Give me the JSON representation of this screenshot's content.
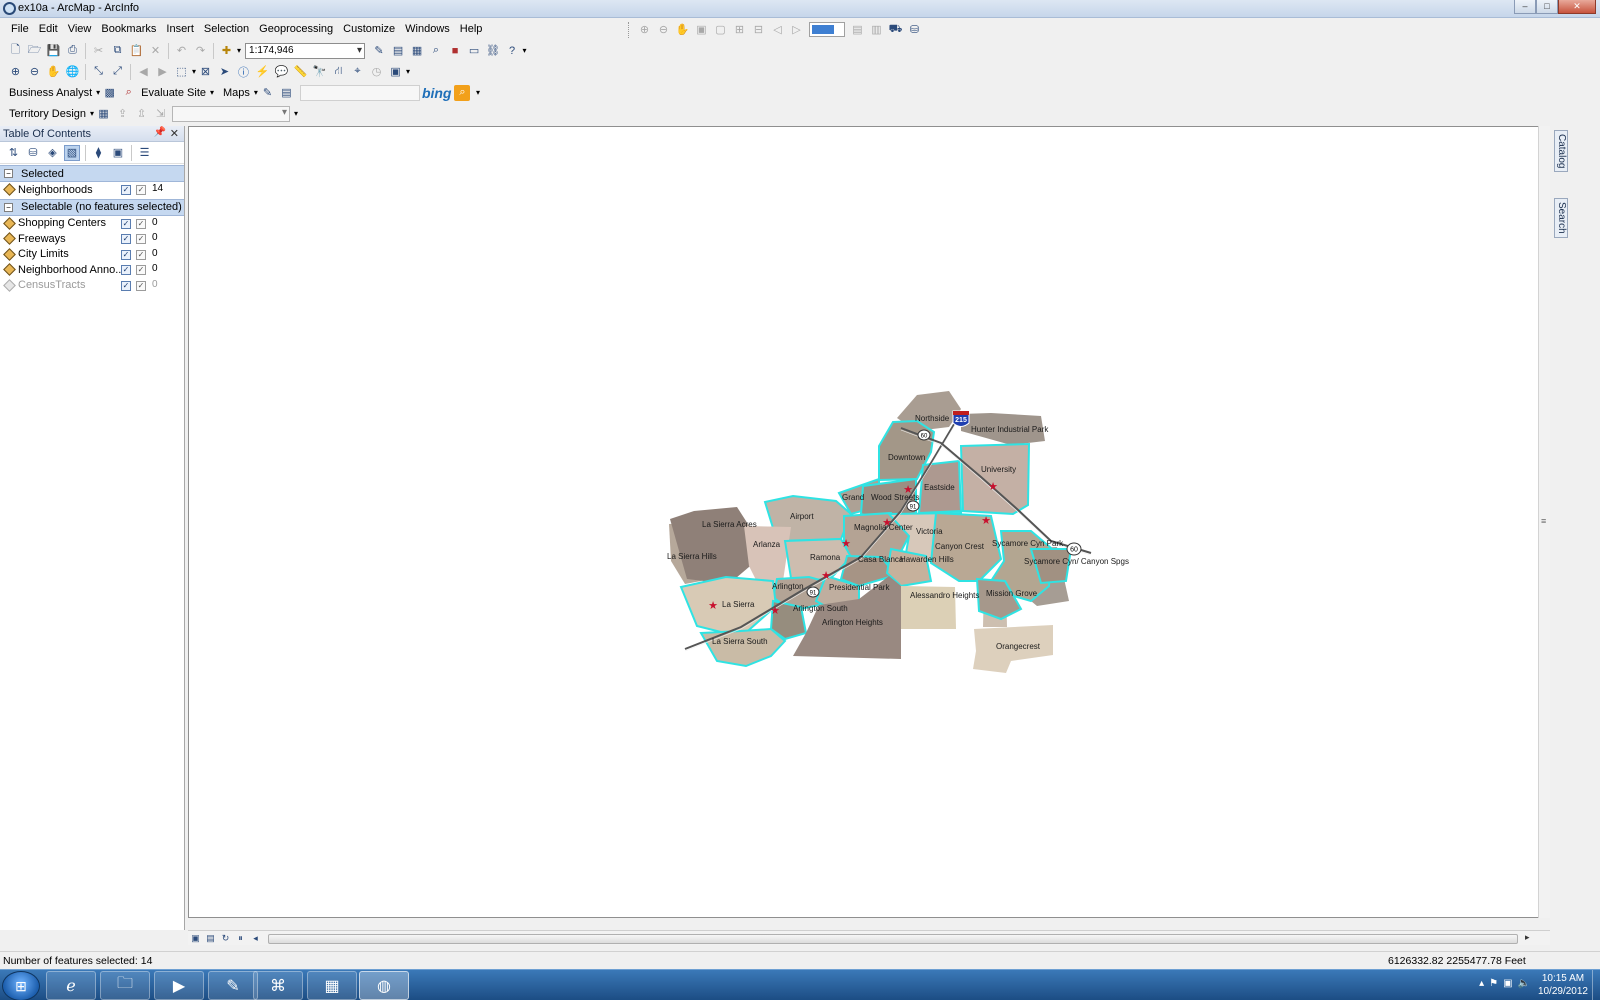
{
  "window": {
    "title": "ex10a - ArcMap - ArcInfo",
    "minimize": "–",
    "maximize": "□",
    "close": "✕"
  },
  "menu": [
    "File",
    "Edit",
    "View",
    "Bookmarks",
    "Insert",
    "Selection",
    "Geoprocessing",
    "Customize",
    "Windows",
    "Help"
  ],
  "toolbar": {
    "scale": "1:174,946"
  },
  "business_analyst": {
    "label": "Business Analyst",
    "evaluate_site": "Evaluate Site",
    "maps": "Maps",
    "bing": "bing"
  },
  "territory": {
    "label": "Territory Design"
  },
  "toc": {
    "title": "Table Of Contents",
    "selected_group": "Selected",
    "selectable_group": "Selectable (no features selected)",
    "selected_layers": [
      {
        "name": "Neighborhoods",
        "count": "14"
      }
    ],
    "selectable_layers": [
      {
        "name": "Shopping Centers",
        "count": "0"
      },
      {
        "name": "Freeways",
        "count": "0"
      },
      {
        "name": "City Limits",
        "count": "0"
      },
      {
        "name": "Neighborhood Anno...",
        "count": "0"
      },
      {
        "name": "CensusTracts",
        "count": "0"
      }
    ]
  },
  "map": {
    "neighborhood_labels": [
      "Northside",
      "Hunter Industrial Park",
      "Downtown",
      "University",
      "Eastside",
      "Grand",
      "Wood Streets",
      "Airport",
      "La Sierra Acres",
      "Magnolia Center",
      "Victoria",
      "Canyon Crest",
      "Arlanza",
      "La Sierra Hills",
      "Ramona",
      "Casa Blanca",
      "Hawarden Hills",
      "Sycamore Cyn Park",
      "Sycamore Cyn/ Canyon Spgs",
      "Arlington",
      "Presidential Park",
      "La Sierra",
      "Arlington South",
      "Arlington Heights",
      "Alessandro Heights",
      "Mission Grove",
      "La Sierra South",
      "Orangecrest"
    ],
    "shields": [
      "215",
      "60",
      "91"
    ]
  },
  "status": {
    "selected": "Number of features selected: 14",
    "coordinates": "6126332.82  2255477.78 Feet"
  },
  "dock": {
    "catalog": "Catalog",
    "search": "Search"
  },
  "clock": {
    "time": "10:15 AM",
    "date": "10/29/2012"
  }
}
